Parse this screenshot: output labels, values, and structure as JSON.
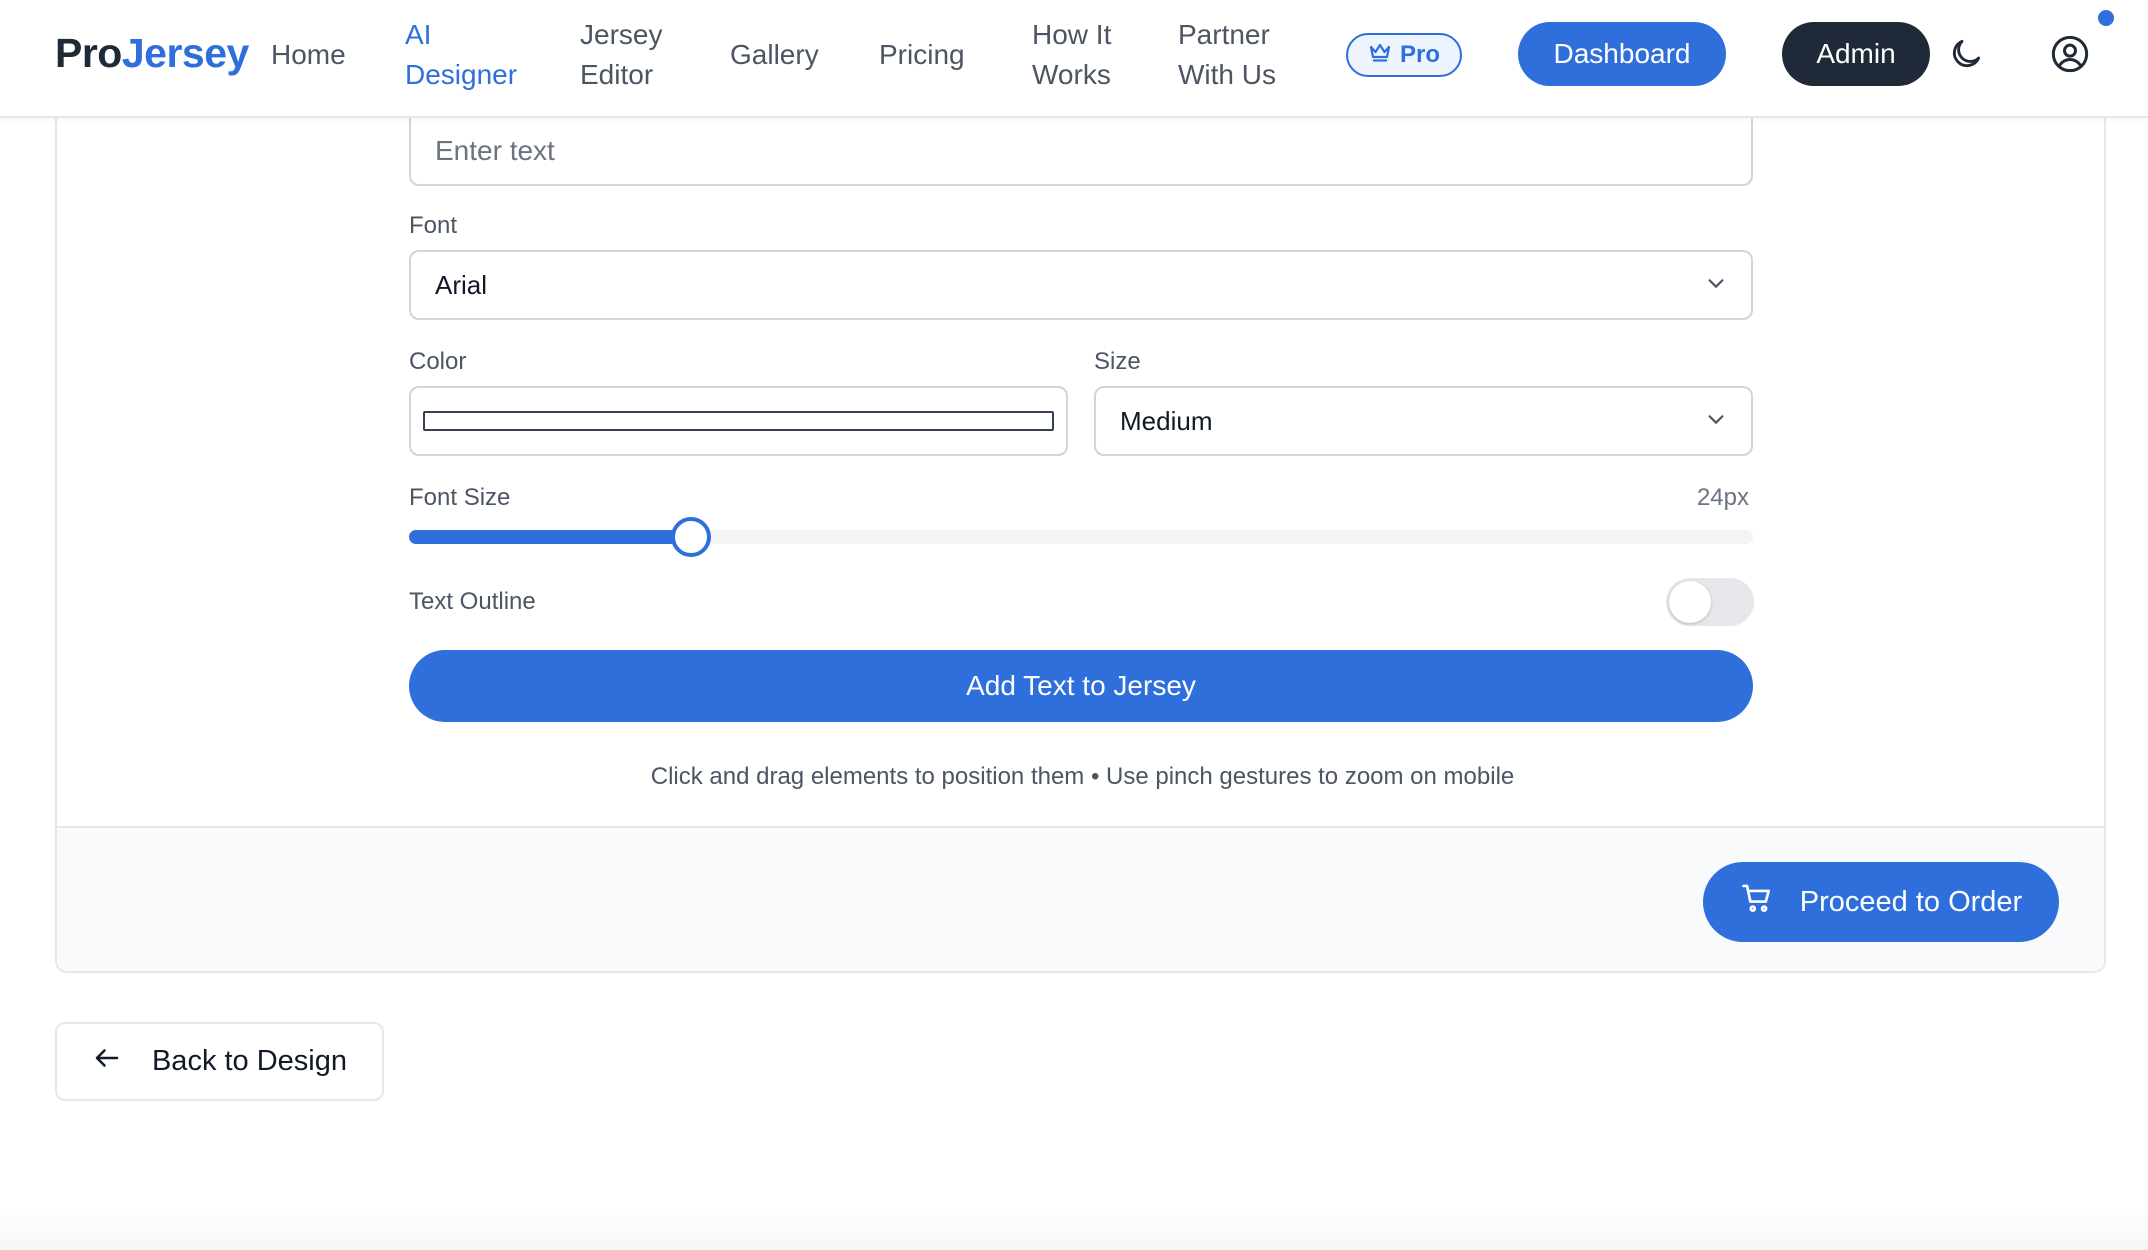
{
  "brand": {
    "part1": "Pro",
    "part2": "Jersey"
  },
  "nav": {
    "home": "Home",
    "ai_designer": [
      "AI",
      "Designer"
    ],
    "jersey_editor": [
      "Jersey",
      "Editor"
    ],
    "gallery": "Gallery",
    "pricing": "Pricing",
    "how_it_works": [
      "How It",
      "Works"
    ],
    "partner": [
      "Partner",
      "With Us"
    ],
    "active": "ai_designer"
  },
  "header": {
    "pro_badge": "Pro",
    "dashboard": "Dashboard",
    "admin": "Admin",
    "icons": [
      "crown-icon",
      "moon-icon",
      "user-circle-icon"
    ]
  },
  "text_form": {
    "text_input": {
      "placeholder": "Enter text",
      "value": ""
    },
    "font": {
      "label": "Font",
      "selected": "Arial"
    },
    "color": {
      "label": "Color",
      "value": "#ffffff"
    },
    "size": {
      "label": "Size",
      "selected": "Medium"
    },
    "font_size": {
      "label": "Font Size",
      "readout": "24px",
      "fraction": 0.21
    },
    "text_outline": {
      "label": "Text Outline",
      "enabled": false
    },
    "add_button": "Add Text to Jersey",
    "hint": "Click and drag elements to position them • Use pinch gestures to zoom on mobile"
  },
  "footer": {
    "proceed": "Proceed to Order",
    "icon": "cart-icon"
  },
  "back_button": {
    "label": "Back to Design",
    "icon": "arrow-left-icon"
  },
  "colors": {
    "accent": "#2f6fdb",
    "dark": "#1f2937",
    "border": "#d1d5db"
  }
}
